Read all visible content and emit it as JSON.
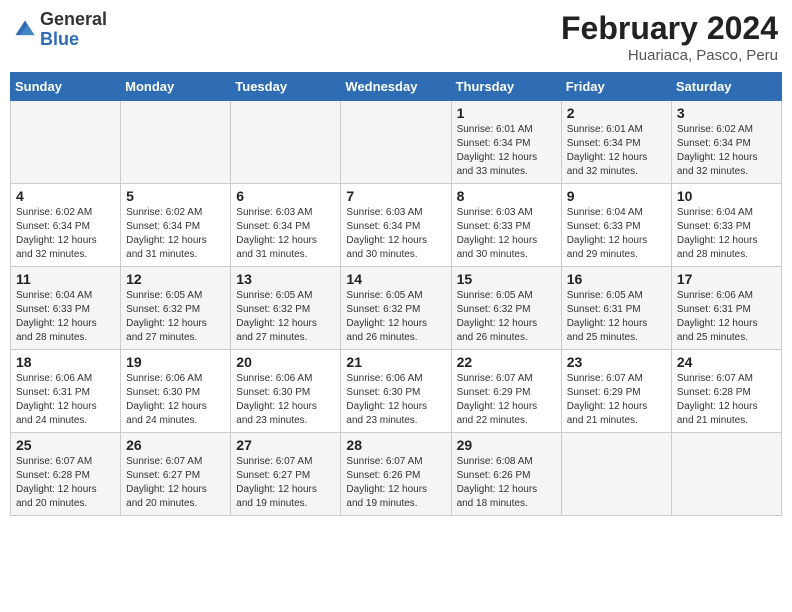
{
  "logo": {
    "line1": "General",
    "line2": "Blue"
  },
  "title": "February 2024",
  "subtitle": "Huariaca, Pasco, Peru",
  "weekdays": [
    "Sunday",
    "Monday",
    "Tuesday",
    "Wednesday",
    "Thursday",
    "Friday",
    "Saturday"
  ],
  "weeks": [
    [
      {
        "day": "",
        "info": ""
      },
      {
        "day": "",
        "info": ""
      },
      {
        "day": "",
        "info": ""
      },
      {
        "day": "",
        "info": ""
      },
      {
        "day": "1",
        "info": "Sunrise: 6:01 AM\nSunset: 6:34 PM\nDaylight: 12 hours\nand 33 minutes."
      },
      {
        "day": "2",
        "info": "Sunrise: 6:01 AM\nSunset: 6:34 PM\nDaylight: 12 hours\nand 32 minutes."
      },
      {
        "day": "3",
        "info": "Sunrise: 6:02 AM\nSunset: 6:34 PM\nDaylight: 12 hours\nand 32 minutes."
      }
    ],
    [
      {
        "day": "4",
        "info": "Sunrise: 6:02 AM\nSunset: 6:34 PM\nDaylight: 12 hours\nand 32 minutes."
      },
      {
        "day": "5",
        "info": "Sunrise: 6:02 AM\nSunset: 6:34 PM\nDaylight: 12 hours\nand 31 minutes."
      },
      {
        "day": "6",
        "info": "Sunrise: 6:03 AM\nSunset: 6:34 PM\nDaylight: 12 hours\nand 31 minutes."
      },
      {
        "day": "7",
        "info": "Sunrise: 6:03 AM\nSunset: 6:34 PM\nDaylight: 12 hours\nand 30 minutes."
      },
      {
        "day": "8",
        "info": "Sunrise: 6:03 AM\nSunset: 6:33 PM\nDaylight: 12 hours\nand 30 minutes."
      },
      {
        "day": "9",
        "info": "Sunrise: 6:04 AM\nSunset: 6:33 PM\nDaylight: 12 hours\nand 29 minutes."
      },
      {
        "day": "10",
        "info": "Sunrise: 6:04 AM\nSunset: 6:33 PM\nDaylight: 12 hours\nand 28 minutes."
      }
    ],
    [
      {
        "day": "11",
        "info": "Sunrise: 6:04 AM\nSunset: 6:33 PM\nDaylight: 12 hours\nand 28 minutes."
      },
      {
        "day": "12",
        "info": "Sunrise: 6:05 AM\nSunset: 6:32 PM\nDaylight: 12 hours\nand 27 minutes."
      },
      {
        "day": "13",
        "info": "Sunrise: 6:05 AM\nSunset: 6:32 PM\nDaylight: 12 hours\nand 27 minutes."
      },
      {
        "day": "14",
        "info": "Sunrise: 6:05 AM\nSunset: 6:32 PM\nDaylight: 12 hours\nand 26 minutes."
      },
      {
        "day": "15",
        "info": "Sunrise: 6:05 AM\nSunset: 6:32 PM\nDaylight: 12 hours\nand 26 minutes."
      },
      {
        "day": "16",
        "info": "Sunrise: 6:05 AM\nSunset: 6:31 PM\nDaylight: 12 hours\nand 25 minutes."
      },
      {
        "day": "17",
        "info": "Sunrise: 6:06 AM\nSunset: 6:31 PM\nDaylight: 12 hours\nand 25 minutes."
      }
    ],
    [
      {
        "day": "18",
        "info": "Sunrise: 6:06 AM\nSunset: 6:31 PM\nDaylight: 12 hours\nand 24 minutes."
      },
      {
        "day": "19",
        "info": "Sunrise: 6:06 AM\nSunset: 6:30 PM\nDaylight: 12 hours\nand 24 minutes."
      },
      {
        "day": "20",
        "info": "Sunrise: 6:06 AM\nSunset: 6:30 PM\nDaylight: 12 hours\nand 23 minutes."
      },
      {
        "day": "21",
        "info": "Sunrise: 6:06 AM\nSunset: 6:30 PM\nDaylight: 12 hours\nand 23 minutes."
      },
      {
        "day": "22",
        "info": "Sunrise: 6:07 AM\nSunset: 6:29 PM\nDaylight: 12 hours\nand 22 minutes."
      },
      {
        "day": "23",
        "info": "Sunrise: 6:07 AM\nSunset: 6:29 PM\nDaylight: 12 hours\nand 21 minutes."
      },
      {
        "day": "24",
        "info": "Sunrise: 6:07 AM\nSunset: 6:28 PM\nDaylight: 12 hours\nand 21 minutes."
      }
    ],
    [
      {
        "day": "25",
        "info": "Sunrise: 6:07 AM\nSunset: 6:28 PM\nDaylight: 12 hours\nand 20 minutes."
      },
      {
        "day": "26",
        "info": "Sunrise: 6:07 AM\nSunset: 6:27 PM\nDaylight: 12 hours\nand 20 minutes."
      },
      {
        "day": "27",
        "info": "Sunrise: 6:07 AM\nSunset: 6:27 PM\nDaylight: 12 hours\nand 19 minutes."
      },
      {
        "day": "28",
        "info": "Sunrise: 6:07 AM\nSunset: 6:26 PM\nDaylight: 12 hours\nand 19 minutes."
      },
      {
        "day": "29",
        "info": "Sunrise: 6:08 AM\nSunset: 6:26 PM\nDaylight: 12 hours\nand 18 minutes."
      },
      {
        "day": "",
        "info": ""
      },
      {
        "day": "",
        "info": ""
      }
    ]
  ]
}
